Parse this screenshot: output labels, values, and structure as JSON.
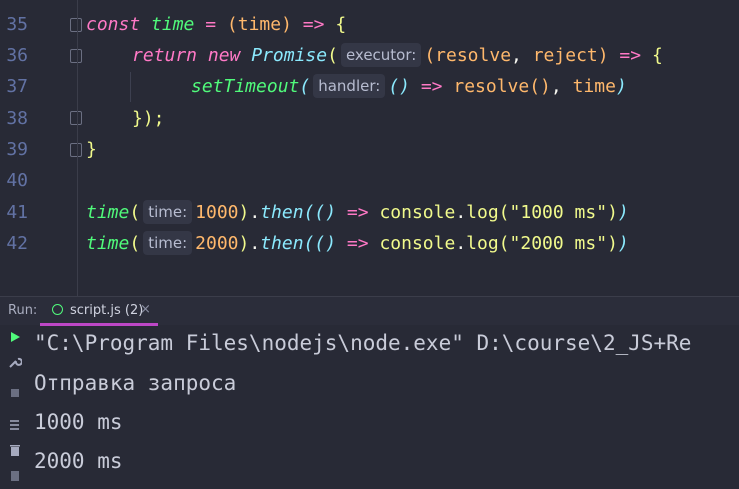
{
  "editor": {
    "line_numbers": [
      "35",
      "36",
      "37",
      "38",
      "39",
      "40",
      "41",
      "42"
    ],
    "hints": {
      "executor": "executor:",
      "handler": "handler:",
      "time1": "time:",
      "time2": "time:"
    },
    "tokens": {
      "const": "const",
      "time": "time",
      "eq": " = ",
      "open_paren": "(",
      "param_time": "time",
      "close_paren": ")",
      "arrow": " => ",
      "open_brace": "{",
      "return": "return",
      "new": "new",
      "promise": "Promise",
      "resolve": "resolve",
      "comma": ", ",
      "reject": "reject",
      "setTimeout": "setTimeout",
      "empty_parens": "()",
      "resolve_call": "resolve",
      "close_stmt": "});",
      "close_brace": "}",
      "num1000": "1000",
      "num2000": "2000",
      "then": "then",
      "console": "console",
      "log": "log",
      "str1000": "\"1000 ms\"",
      "str2000": "\"2000 ms\"",
      "dot": "."
    }
  },
  "run_panel": {
    "label": "Run:",
    "tab_label": "script.js (2)",
    "close_glyph": "×",
    "console_lines": [
      "\"C:\\Program Files\\nodejs\\node.exe\" D:\\course\\2_JS+Re",
      "Отправка запроса",
      "1000 ms",
      "2000 ms"
    ]
  },
  "icons": [
    "play-icon",
    "wrench-icon",
    "stop-icon",
    "soft-wrap-icon",
    "trash-icon"
  ],
  "colors": {
    "background": "#282a36",
    "keyword": "#ff79c6",
    "function": "#50fa7b",
    "class": "#8be9fd",
    "param": "#ffb86c",
    "string": "#f1fa8c",
    "number": "#bd93f9",
    "tab_underline": "#bd47c6"
  }
}
